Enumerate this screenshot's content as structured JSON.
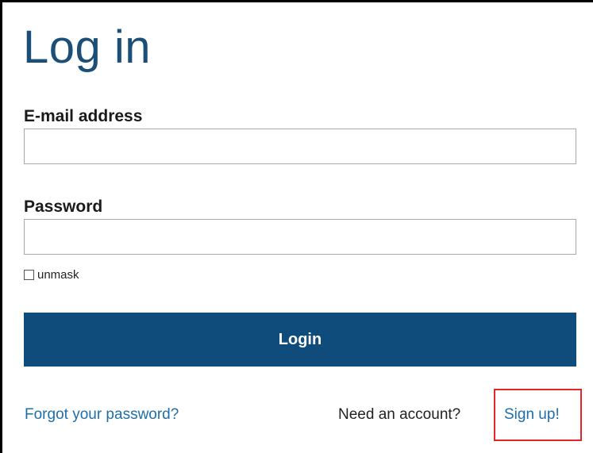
{
  "page": {
    "title": "Log in"
  },
  "form": {
    "email_label": "E-mail address",
    "email_value": "",
    "password_label": "Password",
    "password_value": "",
    "unmask_label": "unmask",
    "unmask_checked": false,
    "login_label": "Login"
  },
  "footer": {
    "forgot_label": "Forgot your password?",
    "need_account_text": "Need an account?",
    "signup_label": "Sign up!"
  },
  "annotation": {
    "highlight_color": "#e3262b",
    "highlight_target": "signup-link"
  },
  "colors": {
    "title": "#1b4f78",
    "button": "#0f4c7c",
    "link": "#1f6ea8"
  }
}
